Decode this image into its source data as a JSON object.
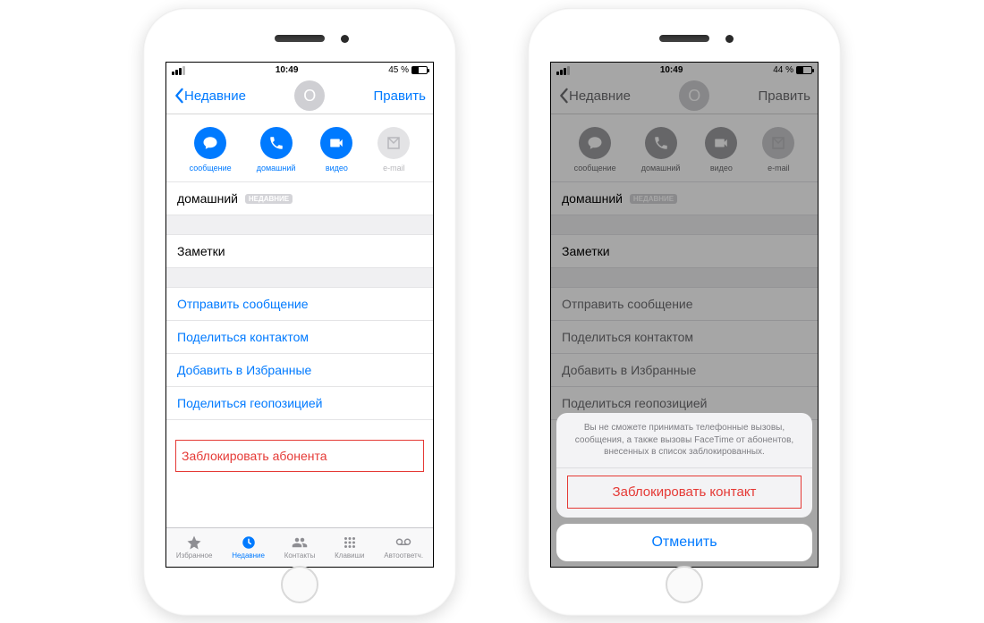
{
  "status": {
    "time": "10:49",
    "battery_left": "45 %",
    "battery_right": "44 %"
  },
  "nav": {
    "back": "Недавние",
    "edit": "Править",
    "avatar_initial": "O"
  },
  "actions": {
    "message": "сообщение",
    "call": "домашний",
    "video": "видео",
    "mail": "e-mail"
  },
  "rows": {
    "phone_label": "домашний",
    "phone_tag": "НЕДАВНИЕ",
    "notes": "Заметки",
    "send_message": "Отправить сообщение",
    "share_contact": "Поделиться контактом",
    "add_favorite": "Добавить в Избранные",
    "share_location": "Поделиться геопозицией",
    "block": "Заблокировать абонента"
  },
  "tabs": {
    "favorites": "Избранное",
    "recents": "Недавние",
    "contacts": "Контакты",
    "keypad": "Клавиши",
    "voicemail": "Автоответч."
  },
  "sheet": {
    "desc": "Вы не сможете принимать телефонные вызовы, сообщения, а также вызовы FaceTime от абонентов, внесенных в список заблокированных.",
    "block": "Заблокировать контакт",
    "cancel": "Отменить"
  }
}
